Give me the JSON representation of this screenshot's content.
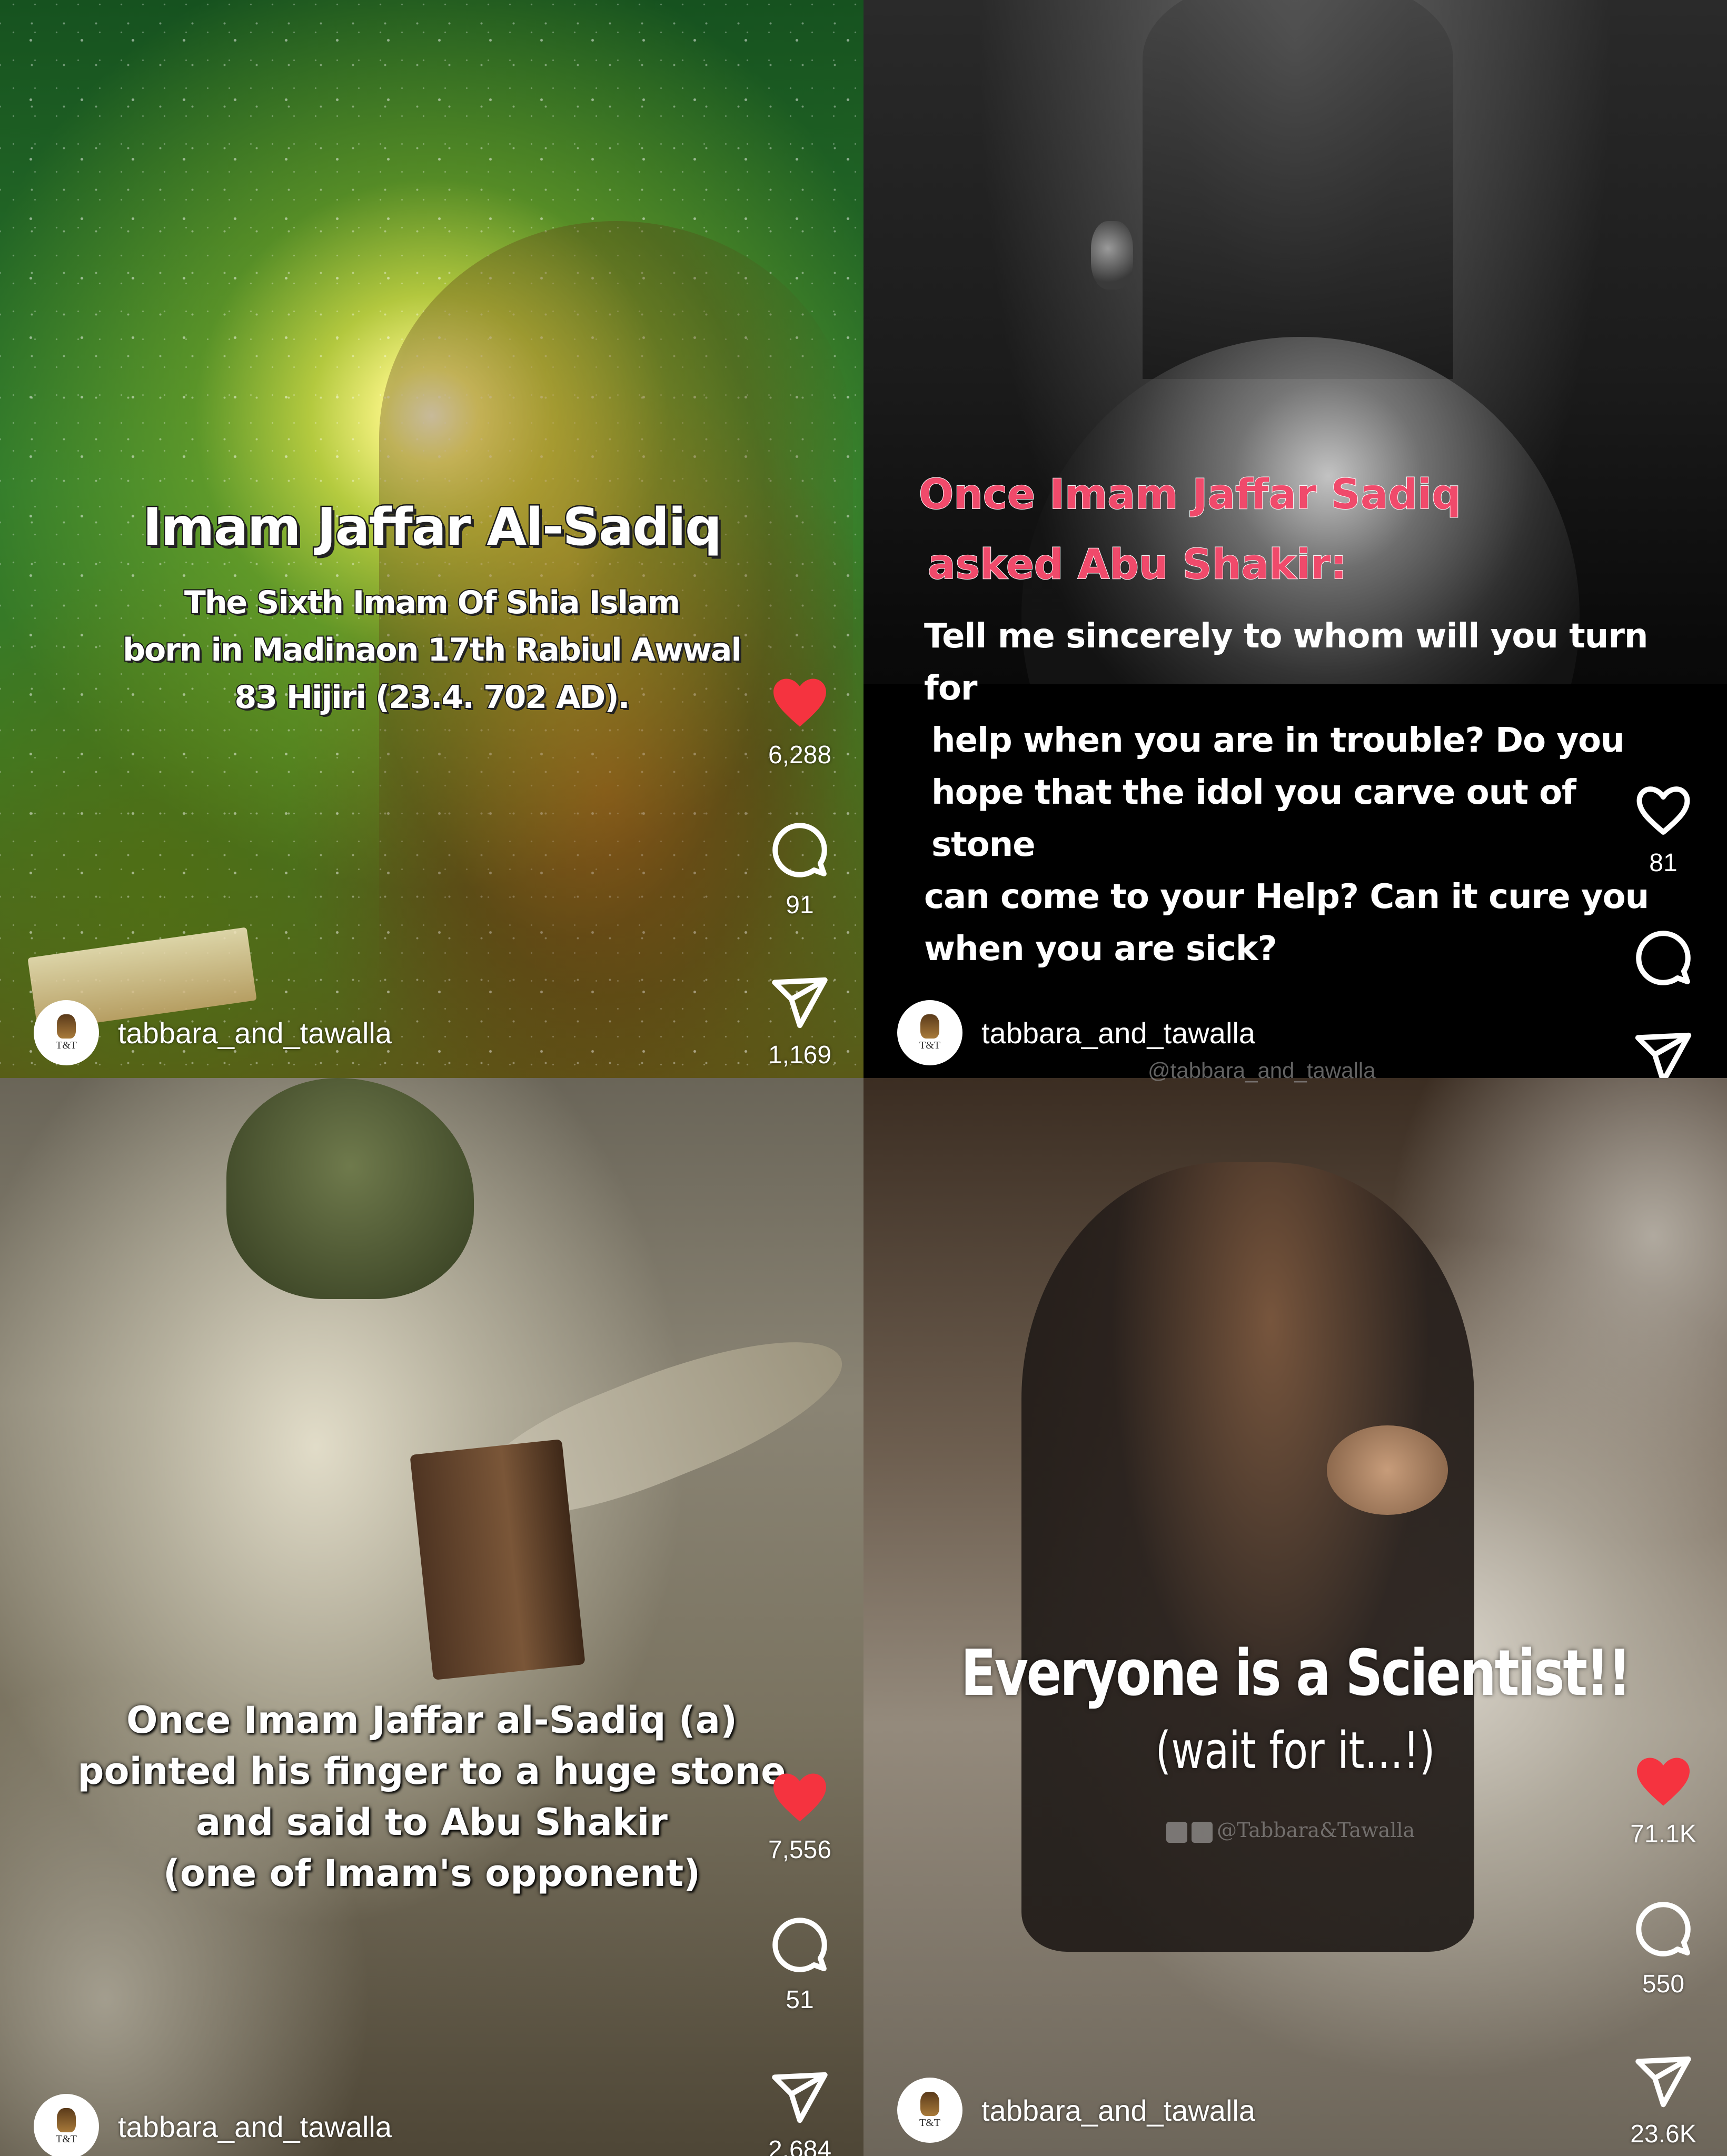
{
  "posts": [
    {
      "lines": [
        "Imam Jaffar Al-Sadiq",
        "The Sixth Imam Of Shia Islam",
        "born in Madinaon 17th Rabiul Awwal",
        "83 Hijiri (23.4. 702 AD)."
      ],
      "likes": "6,288",
      "comments": "91",
      "shares": "1,169",
      "liked": true,
      "username": "tabbara_and_tawalla",
      "avatar_text": "T&T"
    },
    {
      "heading": [
        "Once Imam Jaffar Sadiq",
        "asked Abu Shakir:"
      ],
      "body": [
        "Tell me sincerely to whom will you turn for",
        "help when you are in trouble? Do you",
        "hope that the idol you carve out of stone",
        "can come to your Help? Can it cure you",
        "when you are sick?"
      ],
      "likes": "81",
      "liked": false,
      "username": "tabbara_and_tawalla",
      "avatar_text": "T&T",
      "faded_handle": "@tabbara_and_tawalla"
    },
    {
      "lines": [
        "Once Imam Jaffar al-Sadiq (a)",
        "pointed his finger to a huge stone",
        "and said to Abu Shakir",
        "(one of Imam's opponent)"
      ],
      "likes": "7,556",
      "comments": "51",
      "shares": "2,684",
      "liked": true,
      "username": "tabbara_and_tawalla",
      "avatar_text": "T&T"
    },
    {
      "title": "Everyone is a Scientist!!",
      "subtitle": "(wait for it...!)",
      "watermark": "@Tabbara&Tawalla",
      "likes": "71.1K",
      "comments": "550",
      "shares": "23.6K",
      "liked": true,
      "username": "tabbara_and_tawalla",
      "avatar_text": "T&T"
    }
  ],
  "icons": {
    "like": "heart-icon",
    "comment": "comment-bubble-icon",
    "share": "paper-plane-icon"
  },
  "colors": {
    "like_active": "#f5333f",
    "heading_pink": "#f04a6b",
    "text": "#ffffff"
  }
}
